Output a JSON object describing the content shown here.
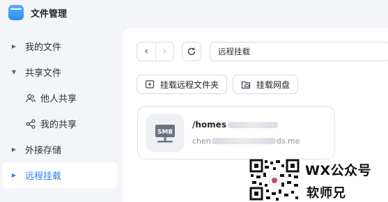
{
  "app": {
    "title": "文件管理"
  },
  "sidebar": {
    "items": [
      {
        "label": "我的文件",
        "state": "collapsed"
      },
      {
        "label": "共享文件",
        "state": "expanded"
      },
      {
        "label": "他人共享",
        "child": true,
        "icon": "people-icon"
      },
      {
        "label": "我的共享",
        "child": true,
        "icon": "share-icon"
      },
      {
        "label": "外接存储",
        "state": "collapsed"
      },
      {
        "label": "远程挂载",
        "state": "collapsed",
        "active": true
      }
    ]
  },
  "toolbar": {
    "back_icon": "‹",
    "forward_icon": "›",
    "path": "远程挂载"
  },
  "actions": {
    "mount_folder": "挂载远程文件夹",
    "mount_drive": "挂载网盘"
  },
  "mount": {
    "badge": "SMB",
    "name_prefix": "/homes",
    "host_prefix": "chen",
    "host_suffix": "ds.me"
  },
  "watermark": {
    "line1": "WX公众号",
    "line2": "软师兄"
  },
  "colors": {
    "accent": "#2f7df6",
    "sidebar_bg": "#f3f5f9",
    "main_bg": "#ffffff"
  }
}
